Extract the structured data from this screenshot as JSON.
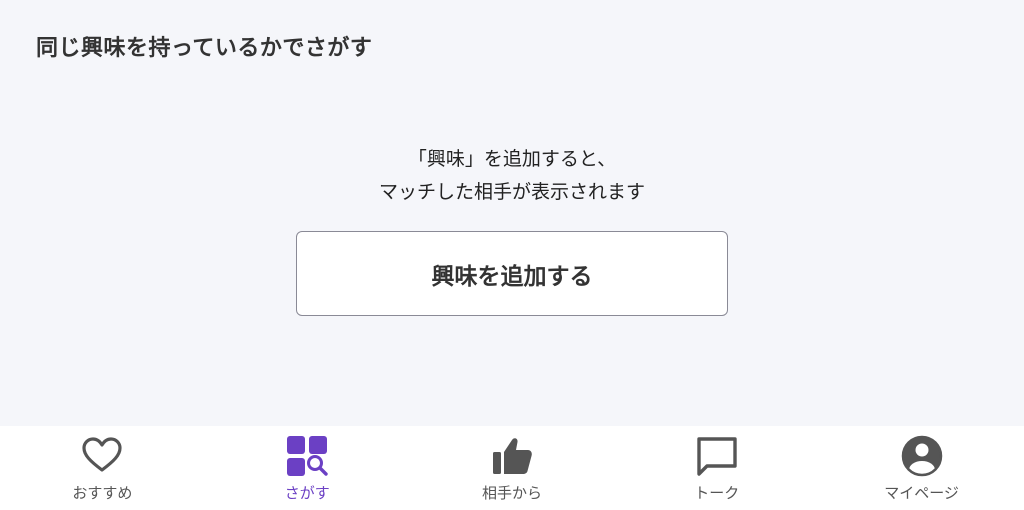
{
  "page": {
    "title": "同じ興味を持っているかでさがす"
  },
  "empty_state": {
    "line1": "「興味」を追加すると、",
    "line2": "マッチした相手が表示されます",
    "button_label": "興味を追加する"
  },
  "tabbar": {
    "active_color": "#6b40c4",
    "tabs": [
      {
        "label": "おすすめ",
        "icon": "heart-icon",
        "active": false
      },
      {
        "label": "さがす",
        "icon": "search-tiles-icon",
        "active": true
      },
      {
        "label": "相手から",
        "icon": "thumbs-up-icon",
        "active": false
      },
      {
        "label": "トーク",
        "icon": "chat-bubble-icon",
        "active": false
      },
      {
        "label": "マイページ",
        "icon": "account-circle-icon",
        "active": false
      }
    ]
  }
}
